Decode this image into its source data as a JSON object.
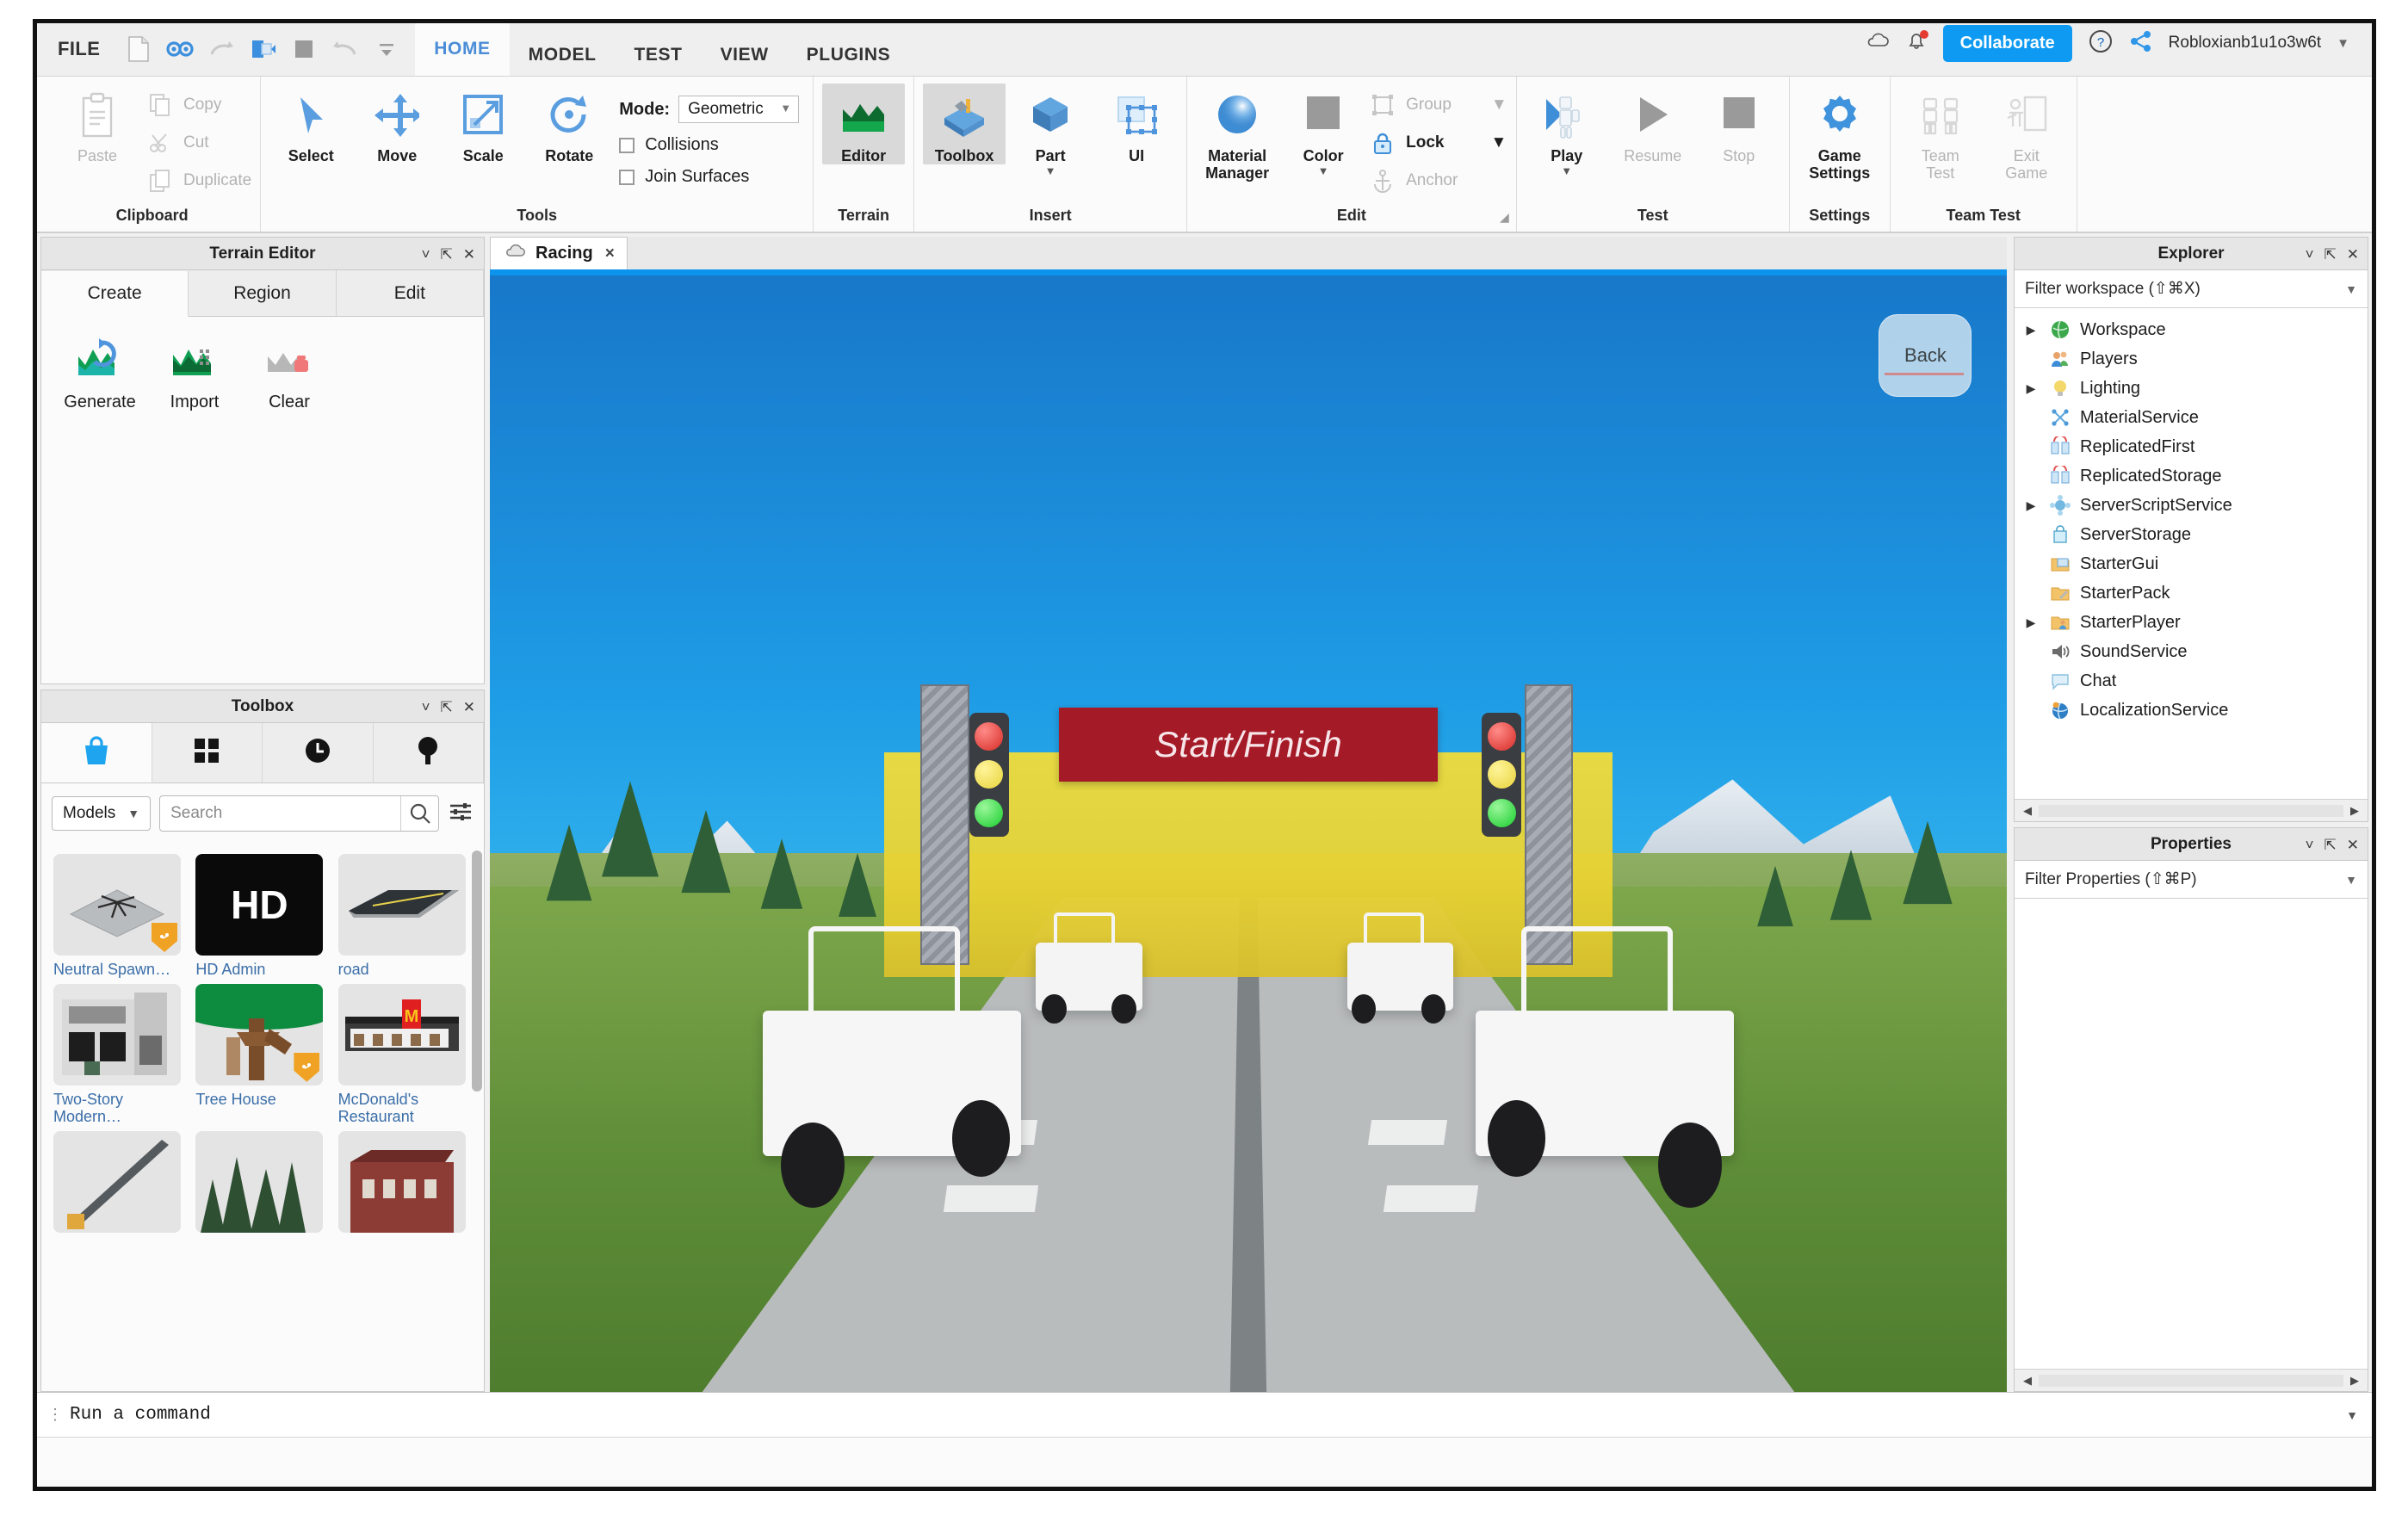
{
  "titlebar": {
    "file_menu": "FILE",
    "qat_icons": [
      "new-file-icon",
      "find-icon",
      "redo-icon",
      "publish-icon",
      "stop-square-icon",
      "undo-icon",
      "overflow-icon"
    ],
    "tabs": [
      "HOME",
      "MODEL",
      "TEST",
      "VIEW",
      "PLUGINS"
    ],
    "active_tab": "HOME",
    "cloud_icon": "cloud-icon",
    "notification_icon": "bell-icon",
    "collaborate_label": "Collaborate",
    "help_icon": "help-circle-icon",
    "share_icon": "share-icon",
    "username": "Robloxianb1u1o3w6t",
    "accent_color": "#0e9af2"
  },
  "ribbon": {
    "groups": [
      {
        "title": "Clipboard",
        "big": [
          {
            "label": "Paste",
            "icon": "clipboard-icon",
            "dim": true
          }
        ],
        "small": [
          {
            "label": "Copy",
            "icon": "copy-icon",
            "dim": true
          },
          {
            "label": "Cut",
            "icon": "scissors-icon",
            "dim": true
          },
          {
            "label": "Duplicate",
            "icon": "duplicate-icon",
            "dim": true
          }
        ]
      },
      {
        "title": "Tools",
        "big": [
          {
            "label": "Select",
            "icon": "cursor-arrow-icon"
          },
          {
            "label": "Move",
            "icon": "move-arrows-icon"
          },
          {
            "label": "Scale",
            "icon": "scale-icon"
          },
          {
            "label": "Rotate",
            "icon": "rotate-icon"
          }
        ],
        "mode_label": "Mode:",
        "mode_value": "Geometric",
        "checkboxes": [
          {
            "label": "Collisions",
            "checked": false
          },
          {
            "label": "Join Surfaces",
            "checked": false
          }
        ]
      },
      {
        "title": "Terrain",
        "big": [
          {
            "label": "Editor",
            "icon": "terrain-editor-icon",
            "active": true
          }
        ]
      },
      {
        "title": "Insert",
        "big": [
          {
            "label": "Toolbox",
            "icon": "toolbox-icon",
            "active": true
          },
          {
            "label": "Part",
            "icon": "part-cube-icon",
            "has_dropdown": true
          },
          {
            "label": "UI",
            "icon": "ui-frame-icon"
          }
        ]
      },
      {
        "title": "Edit",
        "big": [
          {
            "label": "Material\nManager",
            "icon": "material-sphere-icon"
          },
          {
            "label": "Color",
            "icon": "color-swatch-icon",
            "has_dropdown": true
          }
        ],
        "small": [
          {
            "label": "Group",
            "icon": "group-icon",
            "dim": true,
            "has_dropdown": true
          },
          {
            "label": "Lock",
            "icon": "lock-icon",
            "dim": false,
            "has_dropdown": true
          },
          {
            "label": "Anchor",
            "icon": "anchor-icon",
            "dim": true
          }
        ]
      },
      {
        "title": "Test",
        "big": [
          {
            "label": "Play",
            "icon": "play-avatar-icon",
            "has_dropdown": true
          },
          {
            "label": "Resume",
            "icon": "resume-triangle-icon",
            "dim": true
          },
          {
            "label": "Stop",
            "icon": "stop-square-icon",
            "dim": true
          }
        ]
      },
      {
        "title": "Settings",
        "big": [
          {
            "label": "Game\nSettings",
            "icon": "gear-icon"
          }
        ]
      },
      {
        "title": "Team Test",
        "big": [
          {
            "label": "Team\nTest",
            "icon": "team-icon",
            "dim": true
          },
          {
            "label": "Exit\nGame",
            "icon": "exit-game-icon",
            "dim": true
          }
        ]
      }
    ]
  },
  "terrain_editor": {
    "title": "Terrain Editor",
    "controls": [
      "chevron-down-icon",
      "popout-icon",
      "close-icon"
    ],
    "tabs": [
      "Create",
      "Region",
      "Edit"
    ],
    "active_tab": "Create",
    "buttons": [
      {
        "label": "Generate",
        "icon": "terrain-generate-icon"
      },
      {
        "label": "Import",
        "icon": "terrain-import-icon"
      },
      {
        "label": "Clear",
        "icon": "terrain-clear-icon"
      }
    ]
  },
  "toolbox": {
    "title": "Toolbox",
    "controls": [
      "chevron-down-icon",
      "popout-icon",
      "close-icon"
    ],
    "tabs": [
      {
        "icon": "marketplace-bag-icon",
        "selected": true
      },
      {
        "icon": "inventory-grid-icon",
        "selected": false
      },
      {
        "icon": "recent-clock-icon",
        "selected": false
      },
      {
        "icon": "creations-pin-icon",
        "selected": false
      }
    ],
    "category": "Models",
    "search_placeholder": "Search",
    "search_value": "",
    "search_icon": "search-icon",
    "filter_icon": "filter-sliders-icon",
    "assets": [
      {
        "name": "Neutral Spawn…",
        "thumb": "spawn-pad-thumb",
        "badge": true
      },
      {
        "name": "HD Admin",
        "thumb": "hd-admin-thumb",
        "badge": false
      },
      {
        "name": "road",
        "thumb": "road-thumb",
        "badge": false
      },
      {
        "name": "Two-Story Modern…",
        "thumb": "two-story-building-thumb",
        "badge": false
      },
      {
        "name": "Tree House",
        "thumb": "tree-house-thumb",
        "badge": true
      },
      {
        "name": "McDonald's Restaurant",
        "thumb": "mcdonalds-thumb",
        "badge": false
      },
      {
        "name": "",
        "thumb": "pole-thumb",
        "badge": false
      },
      {
        "name": "",
        "thumb": "pine-trees-thumb",
        "badge": false
      },
      {
        "name": "",
        "thumb": "red-building-thumb",
        "badge": false
      }
    ]
  },
  "viewport": {
    "tab_label": "Racing",
    "tab_icon": "cloud-icon",
    "tab_close": "×",
    "nav_cube_label": "Back",
    "scene": {
      "banner_text": "Start/Finish",
      "banner_color": "#a51a27",
      "sky_color": "#1e9ce5",
      "ground_color": "#6d9a46",
      "road_color": "#b9bcbd",
      "traffic_lights": [
        "red",
        "yellow",
        "green"
      ]
    }
  },
  "explorer": {
    "title": "Explorer",
    "controls": [
      "chevron-down-icon",
      "popout-icon",
      "close-icon"
    ],
    "filter_placeholder": "Filter workspace (⇧⌘X)",
    "items": [
      {
        "label": "Workspace",
        "icon": "workspace-globe-icon",
        "expandable": true
      },
      {
        "label": "Players",
        "icon": "players-icon",
        "expandable": false
      },
      {
        "label": "Lighting",
        "icon": "lighting-bulb-icon",
        "expandable": true
      },
      {
        "label": "MaterialService",
        "icon": "material-service-icon",
        "expandable": false
      },
      {
        "label": "ReplicatedFirst",
        "icon": "replicated-icon",
        "expandable": false
      },
      {
        "label": "ReplicatedStorage",
        "icon": "replicated-icon",
        "expandable": false
      },
      {
        "label": "ServerScriptService",
        "icon": "server-script-icon",
        "expandable": true
      },
      {
        "label": "ServerStorage",
        "icon": "server-storage-icon",
        "expandable": false
      },
      {
        "label": "StarterGui",
        "icon": "starter-gui-icon",
        "expandable": false
      },
      {
        "label": "StarterPack",
        "icon": "starter-pack-icon",
        "expandable": false
      },
      {
        "label": "StarterPlayer",
        "icon": "starter-player-icon",
        "expandable": true
      },
      {
        "label": "SoundService",
        "icon": "sound-service-icon",
        "expandable": false
      },
      {
        "label": "Chat",
        "icon": "chat-bubble-icon",
        "expandable": false
      },
      {
        "label": "LocalizationService",
        "icon": "localization-icon",
        "expandable": false
      }
    ]
  },
  "properties": {
    "title": "Properties",
    "controls": [
      "chevron-down-icon",
      "popout-icon",
      "close-icon"
    ],
    "filter_placeholder": "Filter Properties (⇧⌘P)",
    "rows": []
  },
  "command_bar": {
    "placeholder": "Run a command",
    "value": "",
    "grip_icon": "drag-grip-icon",
    "caret_icon": "chevron-down-icon"
  }
}
